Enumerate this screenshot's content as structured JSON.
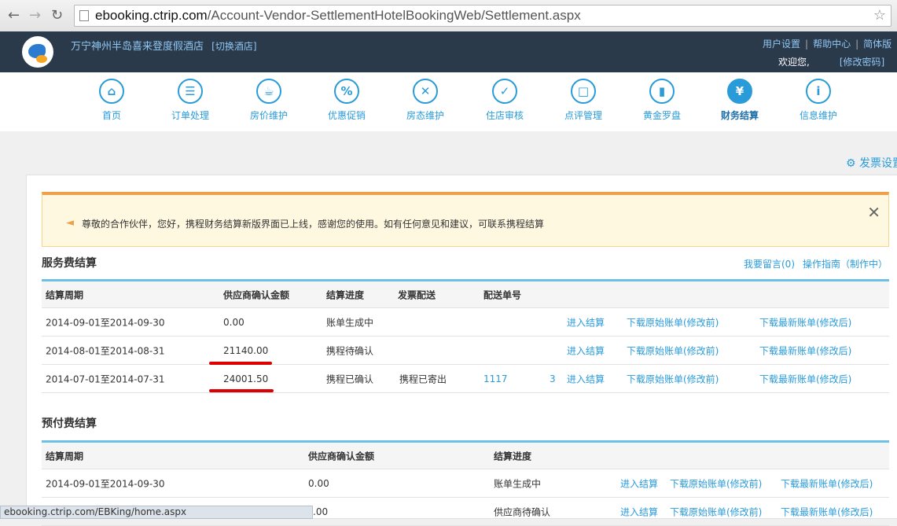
{
  "browser": {
    "url_domain": "ebooking.ctrip.com",
    "url_path": "/Account-Vendor-SettlementHotelBookingWeb/Settlement.aspx",
    "status_url": "ebooking.ctrip.com/EBKing/home.aspx"
  },
  "header": {
    "hotel_name": "万宁神州半岛喜来登度假酒店",
    "switch_hotel": "[切换酒店]",
    "links": [
      "用户设置",
      "帮助中心",
      "简体版"
    ],
    "welcome": "欢迎您,",
    "change_password": "[修改密码]"
  },
  "nav": {
    "items": [
      {
        "label": "首页",
        "icon": "home-icon"
      },
      {
        "label": "订单处理",
        "icon": "list-icon"
      },
      {
        "label": "房价维护",
        "icon": "cup-icon"
      },
      {
        "label": "优惠促销",
        "icon": "tag-icon"
      },
      {
        "label": "房态维护",
        "icon": "tools-icon"
      },
      {
        "label": "住店审核",
        "icon": "clipboard-icon"
      },
      {
        "label": "点评管理",
        "icon": "chat-icon"
      },
      {
        "label": "黄金罗盘",
        "icon": "bar-chart-icon"
      },
      {
        "label": "财务结算",
        "icon": "yen-icon",
        "active": true
      },
      {
        "label": "信息维护",
        "icon": "info-icon"
      }
    ]
  },
  "invoice_settings": "发票设置",
  "notice": {
    "text": "尊敬的合作伙伴，您好，携程财务结算新版界面已上线，感谢您的使用。如有任何意见和建议，可联系携程结算"
  },
  "service_fee": {
    "title": "服务费结算",
    "links": [
      "我要留言(0)",
      "操作指南（制作中）"
    ],
    "headers": [
      "结算周期",
      "供应商确认金额",
      "结算进度",
      "发票配送",
      "配送单号"
    ],
    "rows": [
      {
        "period": "2014-09-01至2014-09-30",
        "amount": "0.00",
        "progress": "账单生成中",
        "invoice": "",
        "tracking": "",
        "actions": [
          "进入结算",
          "下载原始账单(修改前)",
          "下载最新账单(修改后)"
        ]
      },
      {
        "period": "2014-08-01至2014-08-31",
        "amount": "21140.00",
        "progress": "携程待确认",
        "invoice": "",
        "tracking": "",
        "actions": [
          "进入结算",
          "下载原始账单(修改前)",
          "下载最新账单(修改后)"
        ]
      },
      {
        "period": "2014-07-01至2014-07-31",
        "amount": "24001.50",
        "progress": "携程已确认",
        "invoice": "携程已寄出",
        "tracking": "1117",
        "tracking_tail": "3",
        "actions": [
          "进入结算",
          "下载原始账单(修改前)",
          "下载最新账单(修改后)"
        ]
      }
    ]
  },
  "prepay_fee": {
    "title": "预付费结算",
    "headers": [
      "结算周期",
      "供应商确认金额",
      "结算进度"
    ],
    "rows": [
      {
        "period": "2014-09-01至2014-09-30",
        "amount": "0.00",
        "progress": "账单生成中",
        "actions": [
          "进入结算",
          "下载原始账单(修改前)",
          "下载最新账单(修改后)"
        ]
      },
      {
        "period": "",
        "amount": ".00",
        "progress": "供应商待确认",
        "actions": [
          "进入结算",
          "下载原始账单(修改前)",
          "下载最新账单(修改后)"
        ]
      }
    ]
  }
}
